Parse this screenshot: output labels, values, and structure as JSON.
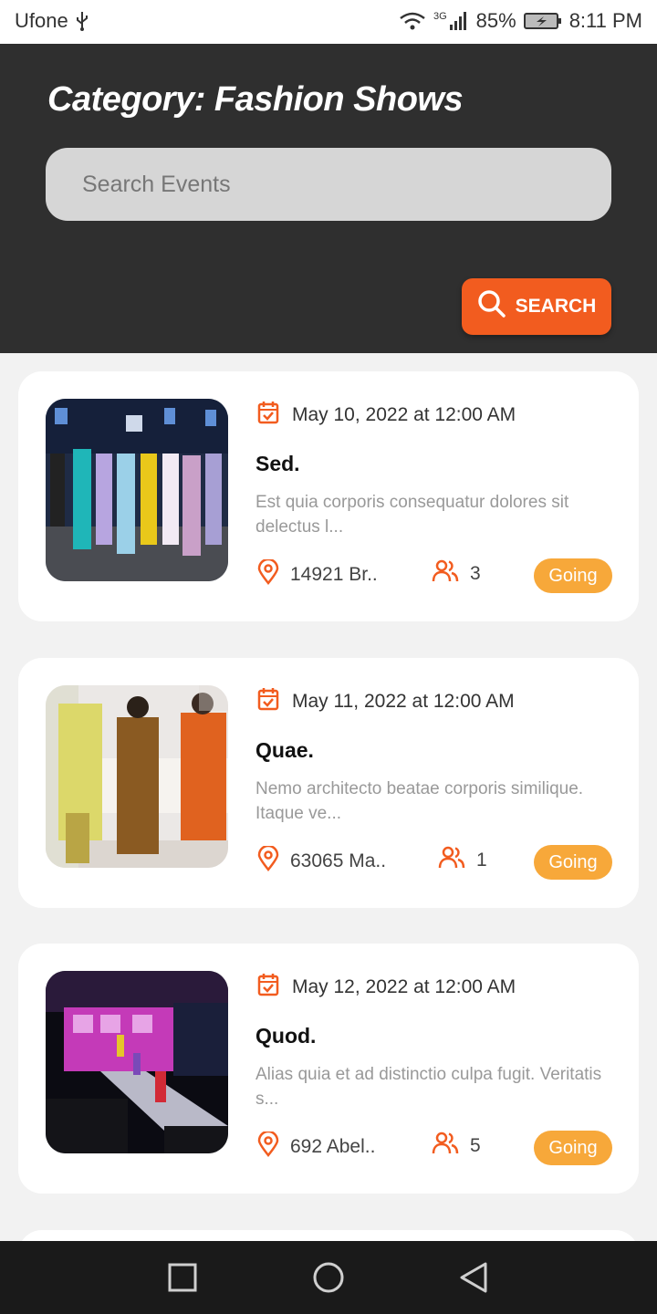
{
  "status_bar": {
    "carrier": "Ufone",
    "network": "3G",
    "battery": "85%",
    "time": "8:11 PM"
  },
  "header": {
    "title": "Category: Fashion Shows",
    "search_placeholder": "Search Events",
    "search_button": "SEARCH"
  },
  "colors": {
    "accent": "#f25c1f",
    "header_bg": "#2f2f2f",
    "going_badge": "#f7a83a"
  },
  "events": [
    {
      "date": "May 10, 2022 at 12:00 AM",
      "title": "Sed.",
      "description": "Est quia corporis consequatur dolores sit delectus l...",
      "location": "14921 Br..",
      "attendees": "3",
      "status": "Going"
    },
    {
      "date": "May 11, 2022 at 12:00 AM",
      "title": "Quae.",
      "description": "Nemo architecto beatae corporis similique. Itaque ve...",
      "location": "63065 Ma..",
      "attendees": "1",
      "status": "Going"
    },
    {
      "date": "May 12, 2022 at 12:00 AM",
      "title": "Quod.",
      "description": "Alias quia et ad distinctio culpa fugit. Veritatis s...",
      "location": "692 Abel..",
      "attendees": "5",
      "status": "Going"
    }
  ],
  "icons": {
    "date": "calendar-check-icon",
    "location": "map-pin-icon",
    "attendees": "users-icon",
    "search": "search-icon"
  }
}
